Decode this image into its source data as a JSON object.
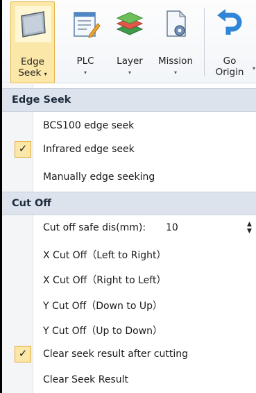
{
  "toolbar": {
    "edge_seek": {
      "label_line1": "Edge",
      "label_line2": "Seek",
      "icon": "edge-seek-icon"
    },
    "plc": {
      "label": "PLC",
      "icon": "plc-icon"
    },
    "layer": {
      "label": "Layer",
      "icon": "layer-icon"
    },
    "mission": {
      "label": "Mission",
      "icon": "mission-icon"
    },
    "go_origin": {
      "label_line1": "Go",
      "label_line2": "Origin",
      "icon": "go-origin-icon"
    },
    "caret": "▾",
    "accent": "#fbe7a8"
  },
  "menu": {
    "edge_seek_header": "Edge Seek",
    "edge_items": [
      {
        "label": "BCS100 edge seek",
        "checked": false
      },
      {
        "label": "Infrared edge seek",
        "checked": true
      },
      {
        "label": "Manually edge seeking",
        "checked": false
      }
    ],
    "cut_off_header": "Cut Off",
    "safe_dis": {
      "label": "Cut off safe dis(mm):",
      "value": "10"
    },
    "cut_items": [
      {
        "label": "X Cut Off（Left to Right）",
        "checked": false
      },
      {
        "label": "X Cut Off（Right to Left）",
        "checked": false
      },
      {
        "label": "Y Cut Off（Down to Up）",
        "checked": false
      },
      {
        "label": "Y Cut Off（Up to Down）",
        "checked": false
      },
      {
        "label": "Clear seek result after cutting",
        "checked": true
      },
      {
        "label": "Clear Seek Result",
        "checked": false
      }
    ],
    "check_glyph": "✓"
  }
}
